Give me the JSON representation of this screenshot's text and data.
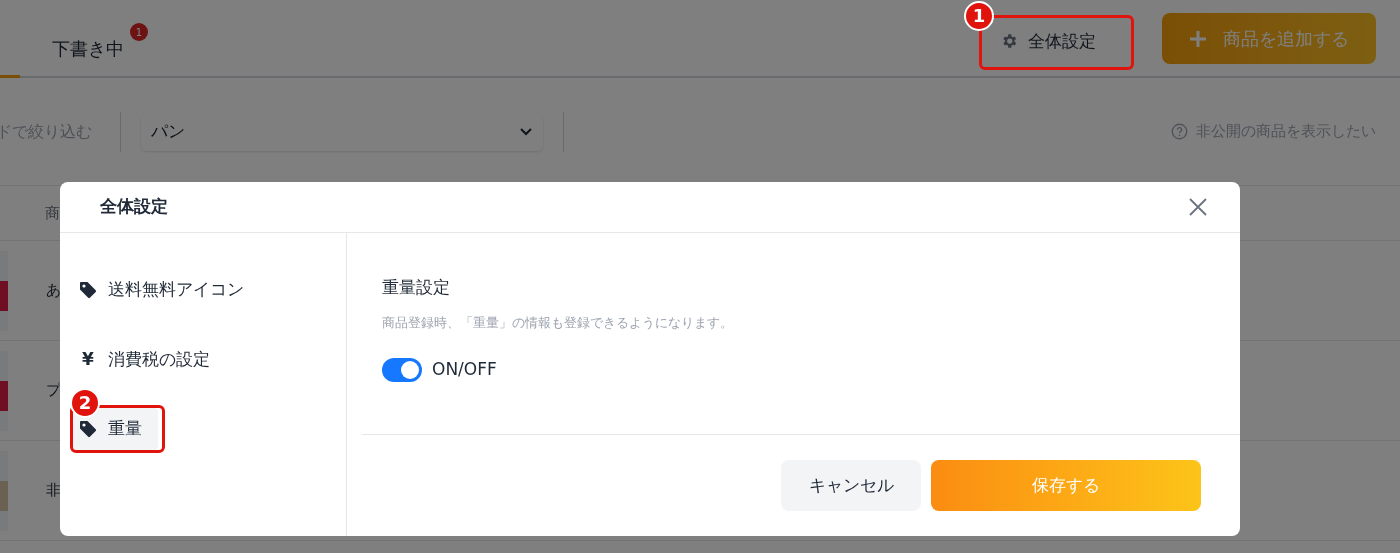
{
  "page": {
    "tabs": [
      {
        "label": "下書き中",
        "badge": "1",
        "selected": false
      }
    ],
    "settings_button": "全体設定",
    "settings_step_badge": "1",
    "add_button": "商品を追加する",
    "filter_label": "ドで絞り込む",
    "category_select": {
      "value": "パン"
    },
    "hidden_link": "非公開の商品を表示したい",
    "table": {
      "header": "商",
      "rows": [
        {
          "cell": "あ"
        },
        {
          "cell": "プ"
        },
        {
          "cell": "非"
        }
      ]
    }
  },
  "modal": {
    "title": "全体設定",
    "menu": [
      {
        "label": "送料無料アイコン",
        "kind": "tag",
        "selected": false
      },
      {
        "label": "消費税の設定",
        "kind": "symbol",
        "symbol": "¥",
        "selected": false
      },
      {
        "label": "重量",
        "kind": "tag",
        "step_badge": "2",
        "selected": true
      }
    ],
    "section": {
      "title": "重量設定",
      "description": "商品登録時、「重量」の情報も登録できるようになります。",
      "toggle": {
        "label": "ON/OFF",
        "on": true
      }
    },
    "buttons": [
      {
        "label": "キャンセル",
        "kind": "secondary"
      },
      {
        "label": "保存する",
        "kind": "primary"
      }
    ]
  }
}
